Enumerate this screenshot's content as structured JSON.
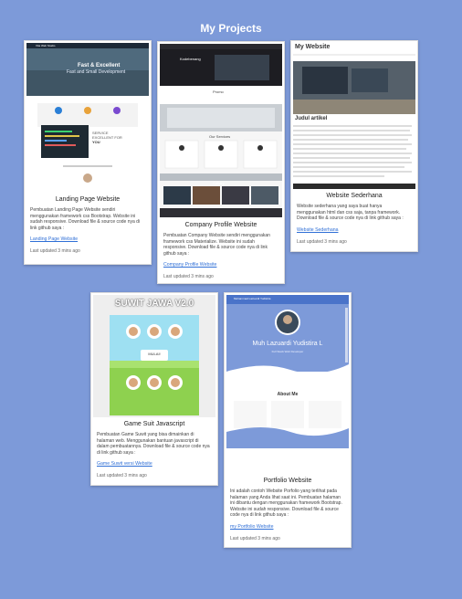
{
  "page": {
    "title": "My Projects"
  },
  "colors": {
    "background": "#7d9ad9",
    "link": "#2f6fd6"
  },
  "projects": [
    {
      "title": "Landing Page Website",
      "description": "Pembuatan Landing Page Website sendiri menggunakan framework css Bootstrap. Website ini sudah responsive. Download file & source code nya di link github saya :",
      "link": "Landing Page Website",
      "updated": "Last updated 3 mins ago",
      "thumb": {
        "brand": "Vita Web Studio",
        "hero_line1": "Fast & Excellent",
        "hero_line2": "Fast and Small Development",
        "service_line1": "SERVICE",
        "service_line2": "EXCELLENT FOR",
        "service_line3": "YOU"
      }
    },
    {
      "title": "Company Profile Website",
      "description": "Pembuatan Company Website sendiri menggunakan framework css Materialize. Website ini sudah responsive. Download file & source code nya di link github saya :",
      "link": "Company Profile Website",
      "updated": "Last updated 3 mins ago",
      "thumb": {
        "brand": "Kodebenang",
        "section1": "Promo",
        "section2": "Our Services",
        "section3": "Gallery"
      }
    },
    {
      "title": "Website Sederhana",
      "description": "Website sederhana yang saya buat hanya menggunakan html dan css saja, tanpa framework. Download file & source code nya di link github saya :",
      "link": "Website Sederhana",
      "updated": "Last updated 3 mins ago",
      "thumb": {
        "site_title": "My Website",
        "article_heading": "Judul artikel"
      }
    },
    {
      "title": "Game Suit Javascript",
      "description": "Pembuatan Game Suwit yang bisa dimainkan di halaman web. Menggunakan bantuan javascript di dalam pembuatannya. Download file & source code nya di link github saya :",
      "link": "Game Suwit versi Website",
      "updated": "Last updated 3 mins ago",
      "thumb": {
        "game_title": "SUWIT JAWA V2.0",
        "center_label": "MULAI!"
      }
    },
    {
      "title": "Portfolio Website",
      "description": "Ini adalah contoh Website Porfolio yang terlihat pada halaman yang Anda lihat saat ini. Pembuatan halaman ini dibantu dengan menggunakan framework Bootstrap. Website ini sudah responsive. Download file & source code nya di link github saya :",
      "link": "my Portfolio Website",
      "updated": "Last updated 3 mins ago",
      "thumb": {
        "nav_brand": "Muhammad Lazuardi Yudistira",
        "name": "Muh Lazuardi Yudistira L",
        "role": "Full Stack Web Developer",
        "about_heading": "About Me"
      }
    }
  ]
}
